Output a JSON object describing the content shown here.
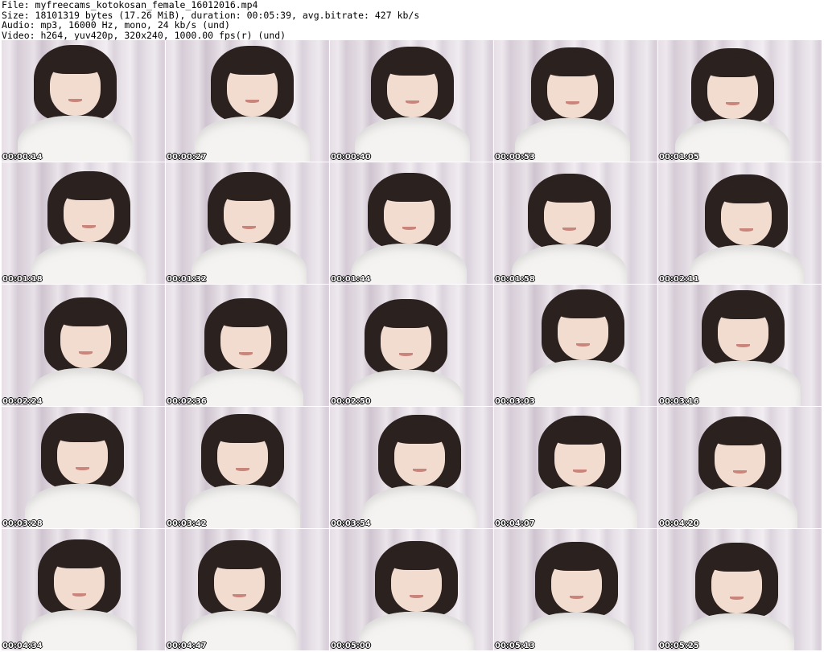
{
  "header": {
    "file_line": "File: myfreecams_kotokosan_female_16012016.mp4",
    "size_line": "Size: 18101319 bytes (17.26 MiB), duration: 00:05:39, avg.bitrate: 427 kb/s",
    "audio_line": "Audio: mp3, 16000 Hz, mono, 24 kb/s (und)",
    "video_line": "Video: h264, yuv420p, 320x240, 1000.00 fps(r) (und)"
  },
  "thumbnails": [
    {
      "timestamp": "00:00:14"
    },
    {
      "timestamp": "00:00:27"
    },
    {
      "timestamp": "00:00:40"
    },
    {
      "timestamp": "00:00:53"
    },
    {
      "timestamp": "00:01:05"
    },
    {
      "timestamp": "00:01:18"
    },
    {
      "timestamp": "00:01:32"
    },
    {
      "timestamp": "00:01:44"
    },
    {
      "timestamp": "00:01:58"
    },
    {
      "timestamp": "00:02:11"
    },
    {
      "timestamp": "00:02:24"
    },
    {
      "timestamp": "00:02:36"
    },
    {
      "timestamp": "00:02:50"
    },
    {
      "timestamp": "00:03:03"
    },
    {
      "timestamp": "00:03:16"
    },
    {
      "timestamp": "00:03:28"
    },
    {
      "timestamp": "00:03:42"
    },
    {
      "timestamp": "00:03:54"
    },
    {
      "timestamp": "00:04:07"
    },
    {
      "timestamp": "00:04:20"
    },
    {
      "timestamp": "00:04:34"
    },
    {
      "timestamp": "00:04:47"
    },
    {
      "timestamp": "00:05:00"
    },
    {
      "timestamp": "00:05:13"
    },
    {
      "timestamp": "00:05:25"
    }
  ]
}
